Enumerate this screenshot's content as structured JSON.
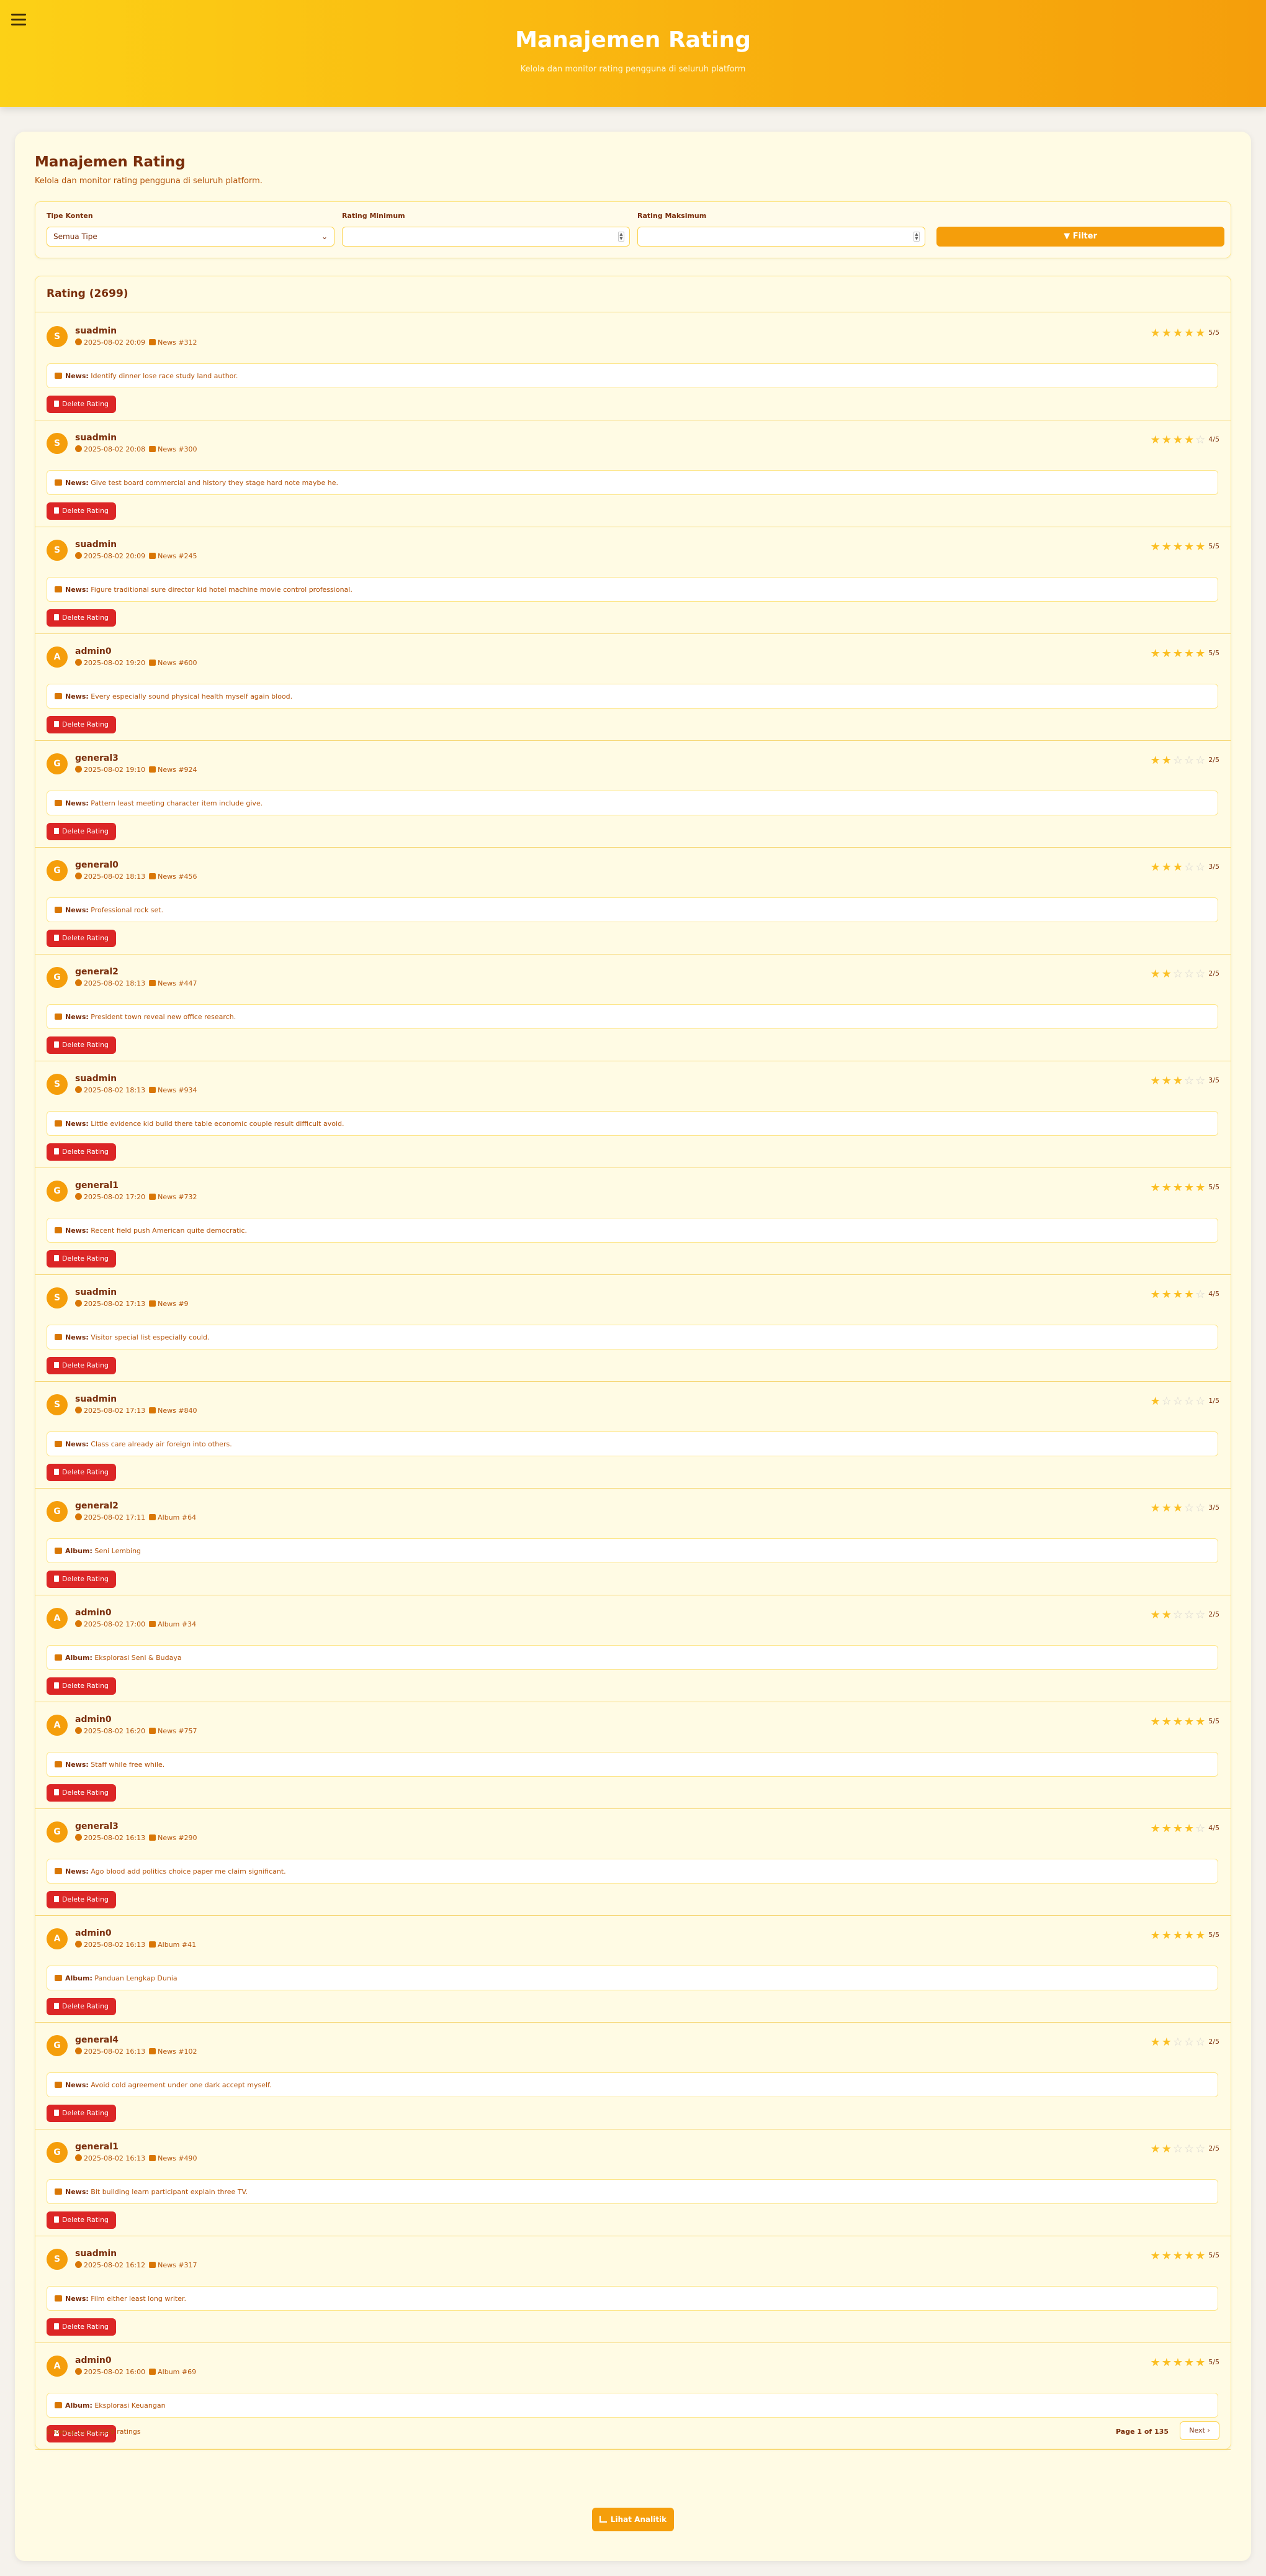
{
  "header": {
    "title": "Manajemen Rating",
    "subtitle": "Kelola dan monitor rating pengguna di seluruh platform"
  },
  "page": {
    "title": "Manajemen Rating",
    "subtitle": "Kelola dan monitor rating pengguna di seluruh platform."
  },
  "filters": {
    "type_label": "Tipe Konten",
    "type_value": "Semua Tipe",
    "min_label": "Rating Minimum",
    "min_value": "",
    "max_label": "Rating Maksimum",
    "max_value": "",
    "button_label": "Filter"
  },
  "list": {
    "title": "Rating (2699)",
    "delete_label": "Delete Rating",
    "items": [
      {
        "initial": "S",
        "user": "suadmin",
        "date": "2025-08-02 20:09",
        "ref": "News #312",
        "score": "5/5",
        "stars": 5,
        "type": "News:",
        "content": "Identify dinner lose race study land author."
      },
      {
        "initial": "S",
        "user": "suadmin",
        "date": "2025-08-02 20:08",
        "ref": "News #300",
        "score": "4/5",
        "stars": 4,
        "type": "News:",
        "content": "Give test board commercial and history they stage hard note maybe he."
      },
      {
        "initial": "S",
        "user": "suadmin",
        "date": "2025-08-02 20:09",
        "ref": "News #245",
        "score": "5/5",
        "stars": 5,
        "type": "News:",
        "content": "Figure traditional sure director kid hotel machine movie control professional."
      },
      {
        "initial": "A",
        "user": "admin0",
        "date": "2025-08-02 19:20",
        "ref": "News #600",
        "score": "5/5",
        "stars": 5,
        "type": "News:",
        "content": "Every especially sound physical health myself again blood."
      },
      {
        "initial": "G",
        "user": "general3",
        "date": "2025-08-02 19:10",
        "ref": "News #924",
        "score": "2/5",
        "stars": 2,
        "type": "News:",
        "content": "Pattern least meeting character item include give."
      },
      {
        "initial": "G",
        "user": "general0",
        "date": "2025-08-02 18:13",
        "ref": "News #456",
        "score": "3/5",
        "stars": 3,
        "type": "News:",
        "content": "Professional rock set."
      },
      {
        "initial": "G",
        "user": "general2",
        "date": "2025-08-02 18:13",
        "ref": "News #447",
        "score": "2/5",
        "stars": 2,
        "type": "News:",
        "content": "President town reveal new office research."
      },
      {
        "initial": "S",
        "user": "suadmin",
        "date": "2025-08-02 18:13",
        "ref": "News #934",
        "score": "3/5",
        "stars": 3,
        "type": "News:",
        "content": "Little evidence kid build there table economic couple result difficult avoid."
      },
      {
        "initial": "G",
        "user": "general1",
        "date": "2025-08-02 17:20",
        "ref": "News #732",
        "score": "5/5",
        "stars": 5,
        "type": "News:",
        "content": "Recent field push American quite democratic."
      },
      {
        "initial": "S",
        "user": "suadmin",
        "date": "2025-08-02 17:13",
        "ref": "News #9",
        "score": "4/5",
        "stars": 4,
        "type": "News:",
        "content": "Visitor special list especially could."
      },
      {
        "initial": "S",
        "user": "suadmin",
        "date": "2025-08-02 17:13",
        "ref": "News #840",
        "score": "1/5",
        "stars": 1,
        "type": "News:",
        "content": "Class care already air foreign into others."
      },
      {
        "initial": "G",
        "user": "general2",
        "date": "2025-08-02 17:11",
        "ref": "Album #64",
        "score": "3/5",
        "stars": 3,
        "type": "Album:",
        "content": "Seni Lembing"
      },
      {
        "initial": "A",
        "user": "admin0",
        "date": "2025-08-02 17:00",
        "ref": "Album #34",
        "score": "2/5",
        "stars": 2,
        "type": "Album:",
        "content": "Eksplorasi Seni & Budaya"
      },
      {
        "initial": "A",
        "user": "admin0",
        "date": "2025-08-02 16:20",
        "ref": "News #757",
        "score": "5/5",
        "stars": 5,
        "type": "News:",
        "content": "Staff while free while."
      },
      {
        "initial": "G",
        "user": "general3",
        "date": "2025-08-02 16:13",
        "ref": "News #290",
        "score": "4/5",
        "stars": 4,
        "type": "News:",
        "content": "Ago blood add politics choice paper me claim significant."
      },
      {
        "initial": "A",
        "user": "admin0",
        "date": "2025-08-02 16:13",
        "ref": "Album #41",
        "score": "5/5",
        "stars": 5,
        "type": "Album:",
        "content": "Panduan Lengkap Dunia"
      },
      {
        "initial": "G",
        "user": "general4",
        "date": "2025-08-02 16:13",
        "ref": "News #102",
        "score": "2/5",
        "stars": 2,
        "type": "News:",
        "content": "Avoid cold agreement under one dark accept myself."
      },
      {
        "initial": "G",
        "user": "general1",
        "date": "2025-08-02 16:13",
        "ref": "News #490",
        "score": "2/5",
        "stars": 2,
        "type": "News:",
        "content": "Bit building learn participant explain three TV."
      },
      {
        "initial": "S",
        "user": "suadmin",
        "date": "2025-08-02 16:12",
        "ref": "News #317",
        "score": "5/5",
        "stars": 5,
        "type": "News:",
        "content": "Film either least long writer."
      },
      {
        "initial": "A",
        "user": "admin0",
        "date": "2025-08-02 16:00",
        "ref": "Album #69",
        "score": "5/5",
        "stars": 5,
        "type": "Album:",
        "content": "Eksplorasi Keuangan"
      }
    ]
  },
  "footer": {
    "showing": "Showing 20 of 2699 ratings",
    "page_info": "Page 1 of 135",
    "next_label": "Next",
    "analytics_label": "Lihat Analitik"
  },
  "colors": {
    "accent": "#f59e0b",
    "danger": "#dc2626",
    "star_on": "#fbbf24",
    "star_off": "#d6d3d1"
  }
}
